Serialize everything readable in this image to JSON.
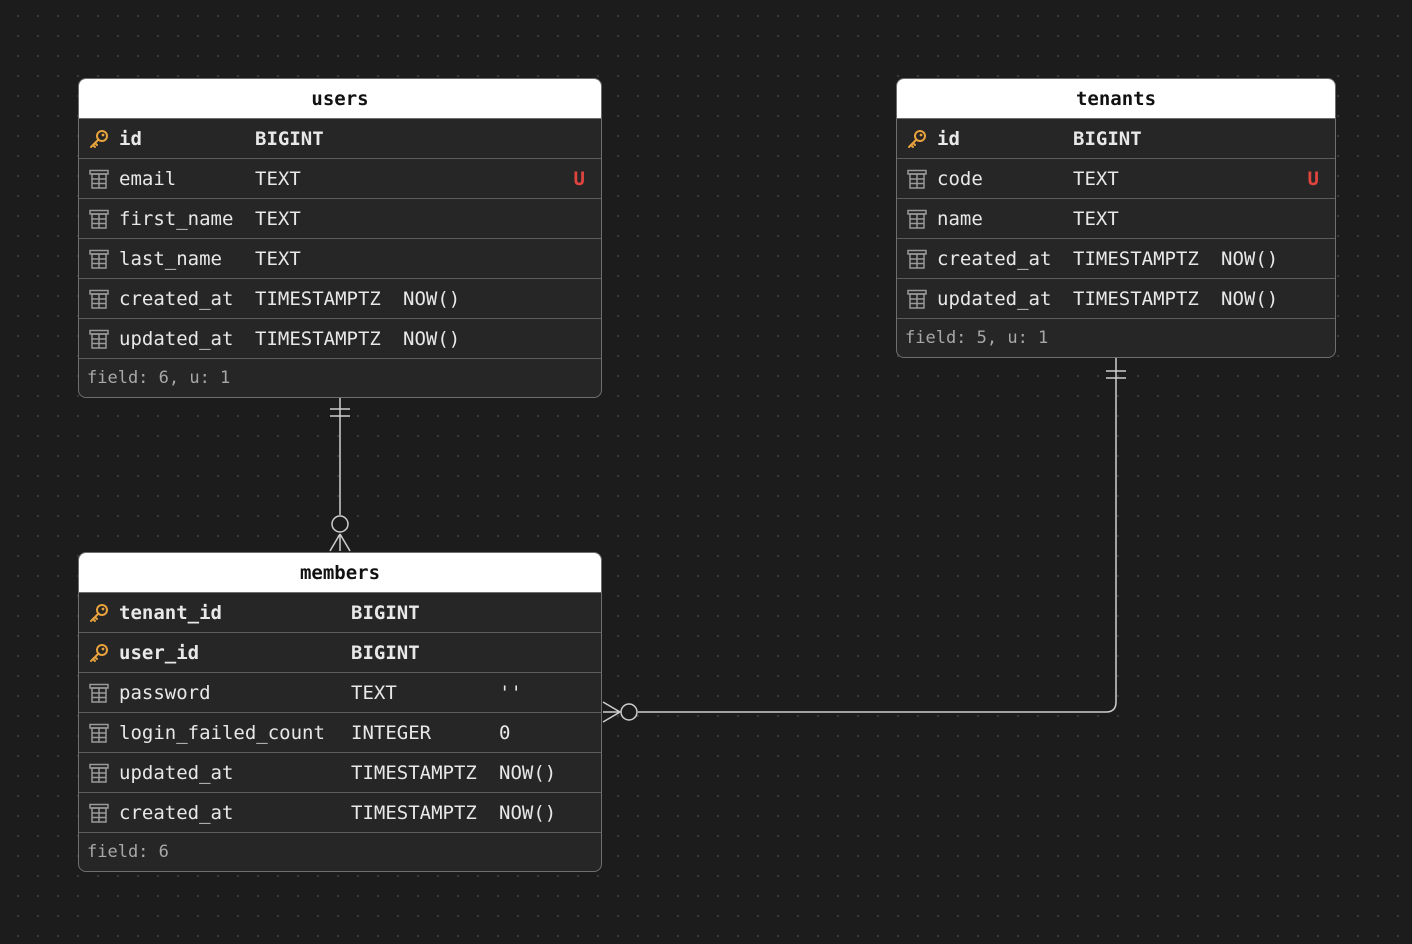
{
  "colors": {
    "background": "#1c1c1c",
    "table_body": "#262626",
    "header": "#ffffff",
    "key_icon": "#e8a33d",
    "unique_marker": "#e0443e",
    "connector": "#cfcfcf"
  },
  "tables": {
    "users": {
      "name": "users",
      "rows": [
        {
          "field": "id",
          "type": "BIGINT",
          "default": "",
          "unique": "",
          "icon": "key-icon"
        },
        {
          "field": "email",
          "type": "TEXT",
          "default": "",
          "unique": "U",
          "icon": "column-icon"
        },
        {
          "field": "first_name",
          "type": "TEXT",
          "default": "",
          "unique": "",
          "icon": "column-icon"
        },
        {
          "field": "last_name",
          "type": "TEXT",
          "default": "",
          "unique": "",
          "icon": "column-icon"
        },
        {
          "field": "created_at",
          "type": "TIMESTAMPTZ",
          "default": "NOW()",
          "unique": "",
          "icon": "column-icon"
        },
        {
          "field": "updated_at",
          "type": "TIMESTAMPTZ",
          "default": "NOW()",
          "unique": "",
          "icon": "column-icon"
        }
      ],
      "footer": "field: 6, u: 1"
    },
    "tenants": {
      "name": "tenants",
      "rows": [
        {
          "field": "id",
          "type": "BIGINT",
          "default": "",
          "unique": "",
          "icon": "key-icon"
        },
        {
          "field": "code",
          "type": "TEXT",
          "default": "",
          "unique": "U",
          "icon": "column-icon"
        },
        {
          "field": "name",
          "type": "TEXT",
          "default": "",
          "unique": "",
          "icon": "column-icon"
        },
        {
          "field": "created_at",
          "type": "TIMESTAMPTZ",
          "default": "NOW()",
          "unique": "",
          "icon": "column-icon"
        },
        {
          "field": "updated_at",
          "type": "TIMESTAMPTZ",
          "default": "NOW()",
          "unique": "",
          "icon": "column-icon"
        }
      ],
      "footer": "field: 5, u: 1"
    },
    "members": {
      "name": "members",
      "rows": [
        {
          "field": "tenant_id",
          "type": "BIGINT",
          "default": "",
          "unique": "",
          "icon": "key-icon"
        },
        {
          "field": "user_id",
          "type": "BIGINT",
          "default": "",
          "unique": "",
          "icon": "key-icon"
        },
        {
          "field": "password",
          "type": "TEXT",
          "default": "''",
          "unique": "",
          "icon": "column-icon"
        },
        {
          "field": "login_failed_count",
          "type": "INTEGER",
          "default": "0",
          "unique": "",
          "icon": "column-icon"
        },
        {
          "field": "updated_at",
          "type": "TIMESTAMPTZ",
          "default": "NOW()",
          "unique": "",
          "icon": "column-icon"
        },
        {
          "field": "created_at",
          "type": "TIMESTAMPTZ",
          "default": "NOW()",
          "unique": "",
          "icon": "column-icon"
        }
      ],
      "footer": "field: 6"
    }
  },
  "relations": [
    {
      "from": "users",
      "to": "members",
      "from_cardinality": "one-and-only-one",
      "to_cardinality": "zero-or-many"
    },
    {
      "from": "tenants",
      "to": "members",
      "from_cardinality": "one-and-only-one",
      "to_cardinality": "zero-or-many"
    }
  ]
}
